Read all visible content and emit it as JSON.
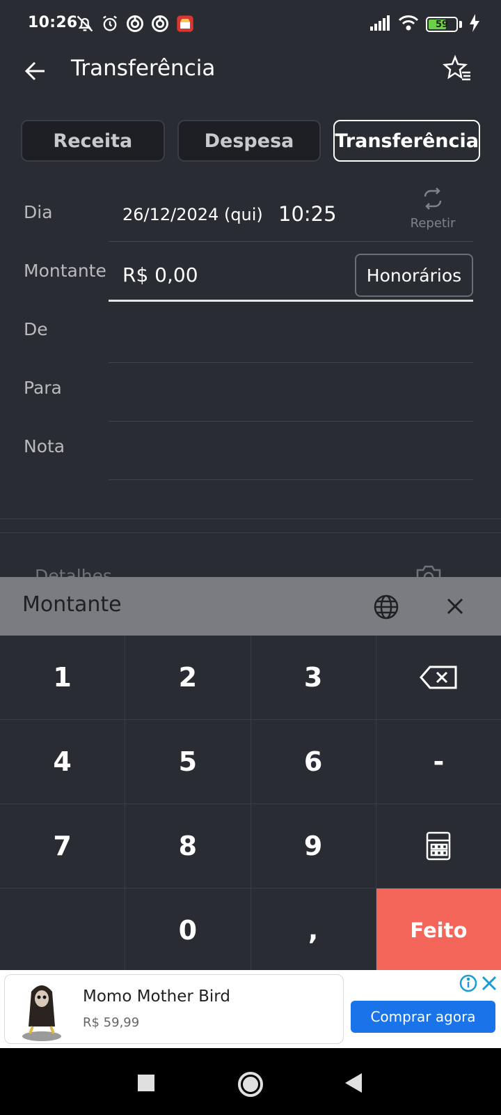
{
  "status_bar": {
    "time": "10:26",
    "battery": "59",
    "battery_level": 0.59
  },
  "app_bar": {
    "title": "Transferência"
  },
  "tabs": [
    {
      "label": "Receita",
      "active": false
    },
    {
      "label": "Despesa",
      "active": false
    },
    {
      "label": "Transferência",
      "active": true
    }
  ],
  "form": {
    "day_label": "Dia",
    "date": "26/12/2024 (qui)",
    "time": "10:25",
    "repeat_label": "Repetir",
    "amount_label": "Montante",
    "amount_value": "R$ 0,00",
    "fees_button": "Honorários",
    "from_label": "De",
    "to_label": "Para",
    "note_label": "Nota",
    "details_label": "Detalhes"
  },
  "keypad": {
    "title": "Montante",
    "keys": [
      "1",
      "2",
      "3",
      "4",
      "5",
      "6",
      "-",
      "7",
      "8",
      "9",
      "0",
      ","
    ],
    "done_label": "Feito"
  },
  "ad": {
    "title": "Momo Mother Bird",
    "price": "R$ 59,99",
    "cta": "Comprar agora"
  },
  "colors": {
    "background": "#2a2c33",
    "done_key": "#f5665a",
    "ad_button": "#1a73e8",
    "keypad_header": "#7a7c82"
  }
}
